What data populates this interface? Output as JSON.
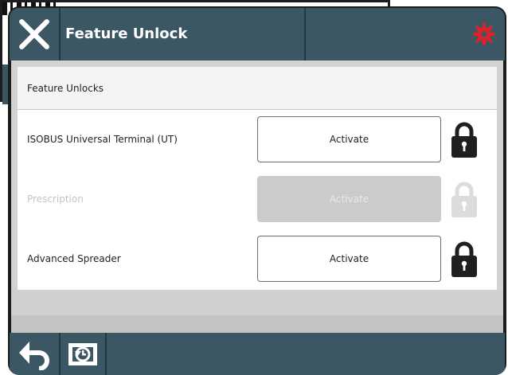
{
  "window": {
    "title": "Feature Unlock"
  },
  "section": {
    "header": "Feature Unlocks"
  },
  "features": [
    {
      "label": "ISOBUS Universal Terminal (UT)",
      "button": "Activate",
      "enabled": true,
      "locked": true
    },
    {
      "label": "Prescription",
      "button": "Activate",
      "enabled": false,
      "locked": true
    },
    {
      "label": "Advanced Spreader",
      "button": "Activate",
      "enabled": true,
      "locked": true
    }
  ],
  "icons": {
    "close": "close-icon",
    "settings": "gear-icon",
    "lock": "lock-icon",
    "back": "back-arrow-icon",
    "reset": "reset-icon"
  },
  "colors": {
    "titlebar": "#3b5764",
    "settings_accent": "#d9232a",
    "disabled_button": "#cbcbcb"
  }
}
